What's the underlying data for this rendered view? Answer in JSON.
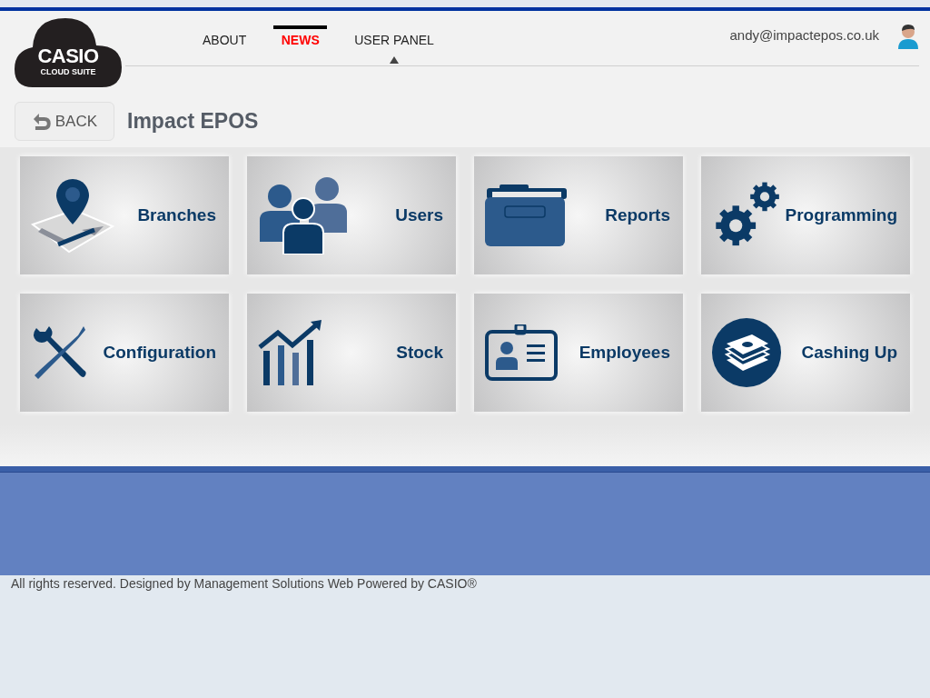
{
  "logo": {
    "brand": "CASIO",
    "product": "CLOUD SUITE"
  },
  "nav": [
    {
      "label": "ABOUT",
      "selected": false,
      "pointer": false
    },
    {
      "label": "NEWS",
      "selected": true,
      "pointer": false
    },
    {
      "label": "USER PANEL",
      "selected": false,
      "pointer": true
    }
  ],
  "user": {
    "email": "andy@impactepos.co.uk"
  },
  "back_button": "BACK",
  "page_title": "Impact EPOS",
  "tiles": [
    {
      "kind": "branches",
      "label": "Branches"
    },
    {
      "kind": "users",
      "label": "Users"
    },
    {
      "kind": "reports",
      "label": "Reports"
    },
    {
      "kind": "programming",
      "label": "Programming"
    },
    {
      "kind": "configuration",
      "label": "Configuration"
    },
    {
      "kind": "stock",
      "label": "Stock"
    },
    {
      "kind": "employees",
      "label": "Employees"
    },
    {
      "kind": "cashing",
      "label": "Cashing Up"
    }
  ],
  "footer": "All rights reserved. Designed by Management Solutions Web Powered by CASIO®"
}
